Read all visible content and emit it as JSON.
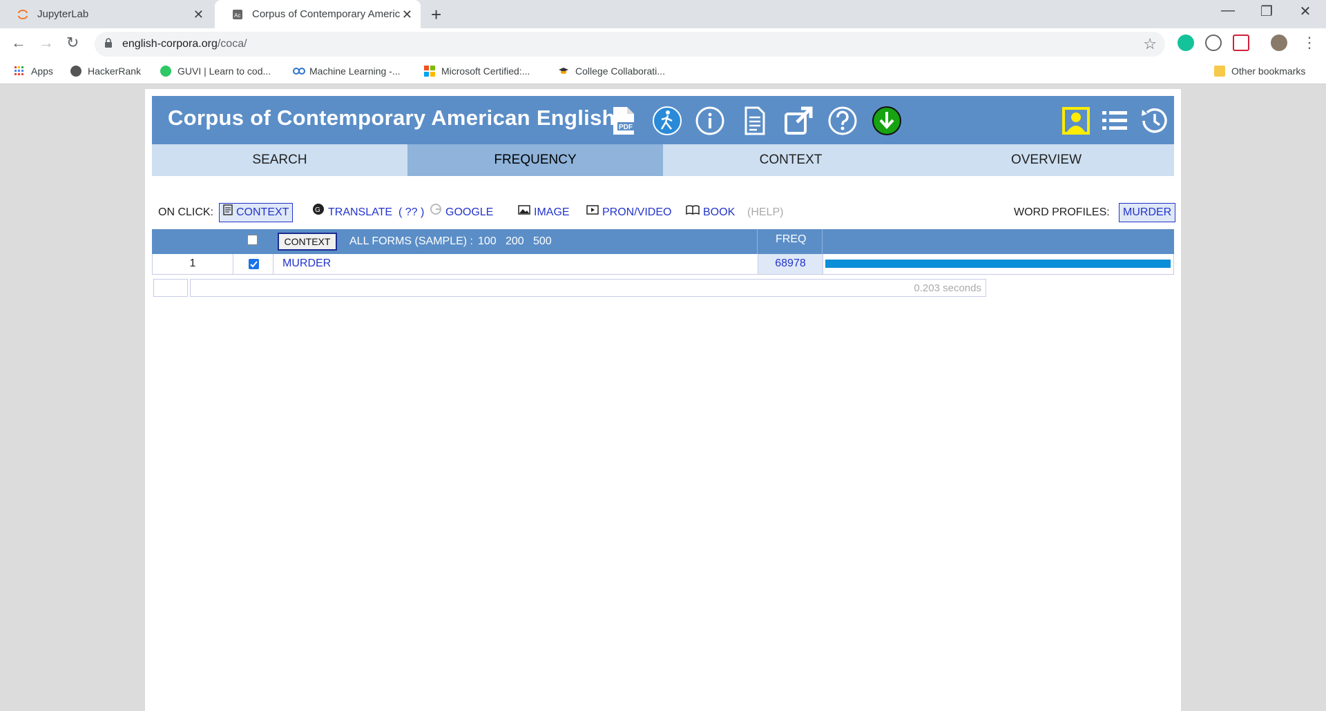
{
  "browser": {
    "tabs": [
      {
        "title": "JupyterLab",
        "active": false
      },
      {
        "title": "Corpus of Contemporary Americ",
        "active": true
      }
    ],
    "url_host": "english-corpora.org",
    "url_path": "/coca/",
    "bookmarks": [
      {
        "label": "Apps"
      },
      {
        "label": "HackerRank"
      },
      {
        "label": "GUVI | Learn to cod..."
      },
      {
        "label": "Machine Learning -..."
      },
      {
        "label": "Microsoft Certified:..."
      },
      {
        "label": "College Collaborati..."
      },
      {
        "label": "Other bookmarks"
      }
    ]
  },
  "site": {
    "title": "Corpus of Contemporary American English",
    "nav_tabs": [
      {
        "label": "SEARCH"
      },
      {
        "label": "FREQUENCY"
      },
      {
        "label": "CONTEXT"
      },
      {
        "label": "OVERVIEW"
      }
    ],
    "active_tab": "FREQUENCY"
  },
  "on_click": {
    "label": "ON CLICK:",
    "context": "CONTEXT",
    "translate": "TRANSLATE",
    "translate_q": "( ?? )",
    "google": "GOOGLE",
    "image": "IMAGE",
    "pron_video": "PRON/VIDEO",
    "book": "BOOK",
    "help": "(HELP)",
    "word_profiles_label": "WORD PROFILES:",
    "word_profiles_value": "MURDER"
  },
  "results": {
    "context_button": "CONTEXT",
    "all_forms_label": "ALL FORMS  (SAMPLE) :",
    "sample_sizes": [
      "100",
      "200",
      "500"
    ],
    "freq_header": "FREQ",
    "rows": [
      {
        "rank": "1",
        "checked": true,
        "word": "MURDER",
        "freq": "68978",
        "bar_fraction": 1.0
      }
    ],
    "time": "0.203 seconds"
  },
  "colors": {
    "header_blue": "#5b8ec7",
    "tab_bg": "#cddff1",
    "tab_active": "#8fb3da",
    "link": "#2233cc",
    "bar": "#0a8fd8"
  }
}
